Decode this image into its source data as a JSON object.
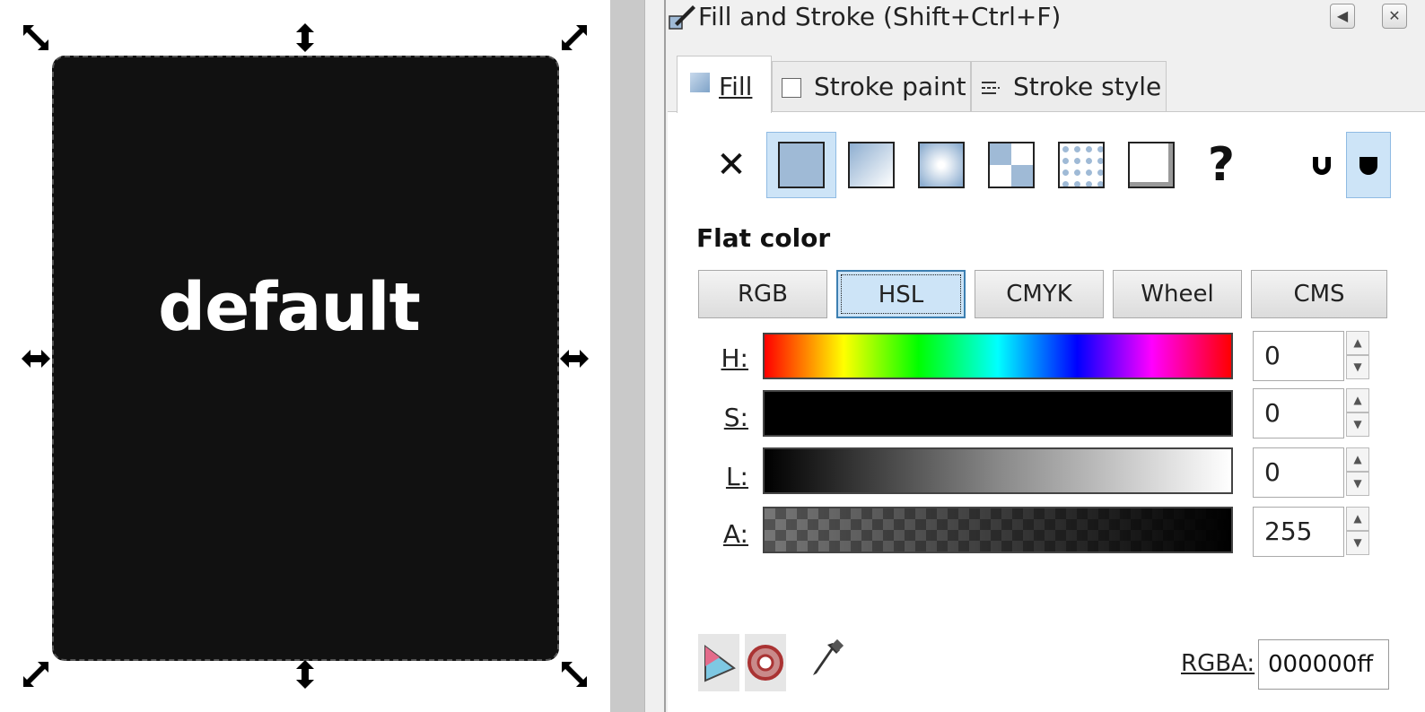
{
  "canvas": {
    "object_text": "default",
    "object_fill": "#111111"
  },
  "dialog": {
    "title": "Fill and Stroke (Shift+Ctrl+F)",
    "tabs": [
      {
        "label": "Fill",
        "active": true
      },
      {
        "label": "Stroke paint",
        "active": false
      },
      {
        "label": "Stroke style",
        "active": false
      }
    ],
    "paint_types": [
      {
        "name": "no-paint",
        "selected": false
      },
      {
        "name": "flat-color",
        "selected": true
      },
      {
        "name": "linear-gradient",
        "selected": false
      },
      {
        "name": "radial-gradient",
        "selected": false
      },
      {
        "name": "pattern",
        "selected": false
      },
      {
        "name": "swatch",
        "selected": false
      },
      {
        "name": "unset",
        "selected": false
      }
    ],
    "fill_rules": [
      {
        "name": "evenodd",
        "selected": false
      },
      {
        "name": "nonzero",
        "selected": true
      }
    ],
    "flat_color_label": "Flat color",
    "modes": [
      {
        "label": "RGB",
        "selected": false
      },
      {
        "label": "HSL",
        "selected": true
      },
      {
        "label": "CMYK",
        "selected": false
      },
      {
        "label": "Wheel",
        "selected": false
      },
      {
        "label": "CMS",
        "selected": false
      }
    ],
    "sliders": [
      {
        "label": "H:",
        "value": "0"
      },
      {
        "label": "S:",
        "value": "0"
      },
      {
        "label": "L:",
        "value": "0"
      },
      {
        "label": "A:",
        "value": "255"
      }
    ],
    "rgba_label": "RGBA:",
    "rgba_value": "000000ff"
  },
  "colors": {
    "accent": "#cde4f7",
    "accent_border": "#3c7fb1",
    "swatch_blue": "#9fbad6"
  }
}
